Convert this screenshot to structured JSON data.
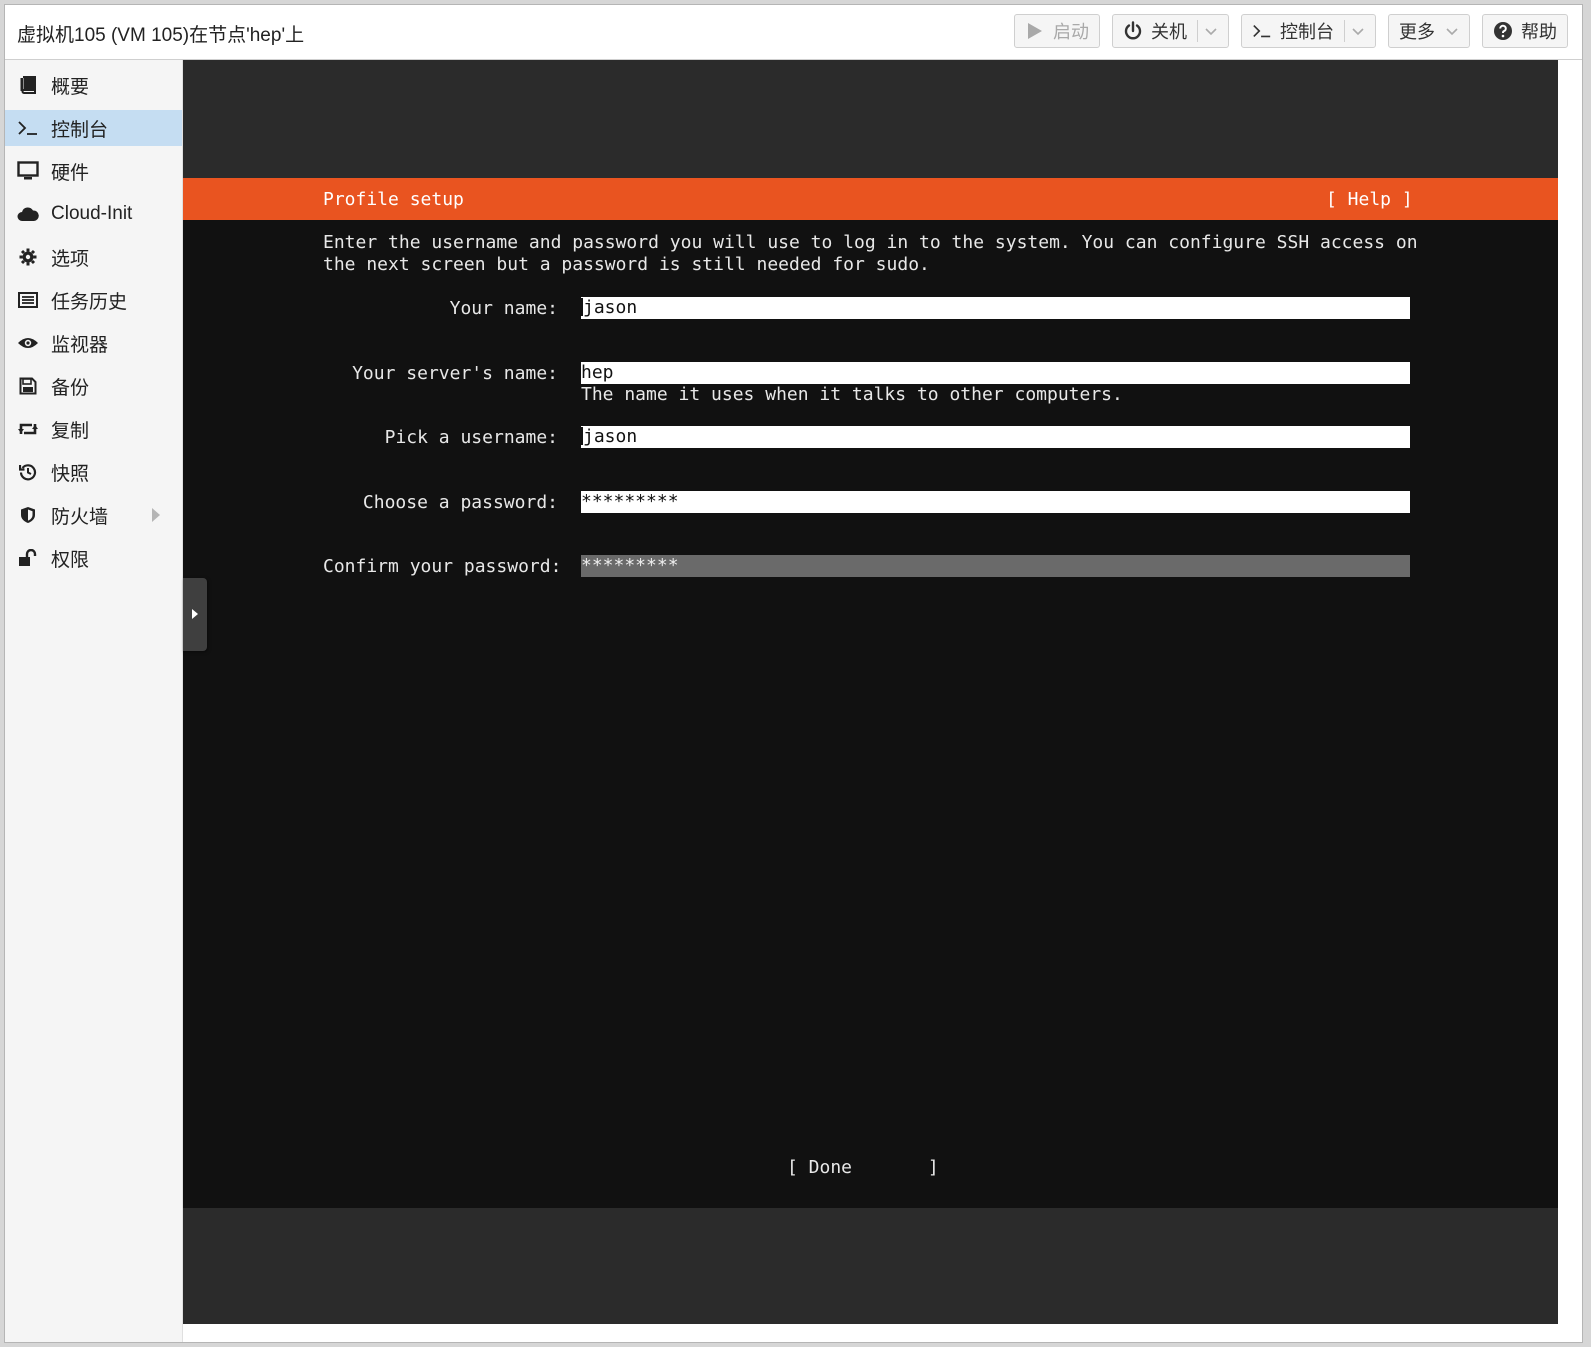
{
  "window": {
    "title": "虚拟机105 (VM 105)在节点'hep'上"
  },
  "toolbar": {
    "start_label": "启动",
    "shutdown_label": "关机",
    "console_label": "控制台",
    "more_label": "更多",
    "help_label": "帮助"
  },
  "sidebar": {
    "items": [
      {
        "label": "概要",
        "icon": "book-icon"
      },
      {
        "label": "控制台",
        "icon": "terminal-icon",
        "active": true
      },
      {
        "label": "硬件",
        "icon": "monitor-icon"
      },
      {
        "label": "Cloud-Init",
        "icon": "cloud-icon"
      },
      {
        "label": "选项",
        "icon": "gear-icon"
      },
      {
        "label": "任务历史",
        "icon": "list-icon"
      },
      {
        "label": "监视器",
        "icon": "eye-icon"
      },
      {
        "label": "备份",
        "icon": "floppy-icon"
      },
      {
        "label": "复制",
        "icon": "retweet-icon"
      },
      {
        "label": "快照",
        "icon": "history-icon"
      },
      {
        "label": "防火墙",
        "icon": "shield-icon",
        "has_submenu": true
      },
      {
        "label": "权限",
        "icon": "unlock-icon"
      }
    ]
  },
  "terminal": {
    "header_title": "Profile setup",
    "help_label": "[ Help ]",
    "intro_line1": "Enter the username and password you will use to log in to the system. You can configure SSH access on",
    "intro_line2": "the next screen but a password is still needed for sudo.",
    "fields": {
      "name_label": "Your name:",
      "name_value": "jason",
      "server_label": "Your server's name:",
      "server_value": "hep",
      "server_hint": "The name it uses when it talks to other computers.",
      "username_label": "Pick a username:",
      "username_value": "jason",
      "password_label": "Choose a password:",
      "password_value": "*********",
      "confirm_label": "Confirm your password:",
      "confirm_value": "*********"
    },
    "done_label": "[ Done       ]"
  },
  "colors": {
    "ubuntu_orange": "#e95420",
    "terminal_bg": "#111111",
    "console_bg": "#2b2b2b",
    "sidebar_active": "#c5ddf2"
  }
}
